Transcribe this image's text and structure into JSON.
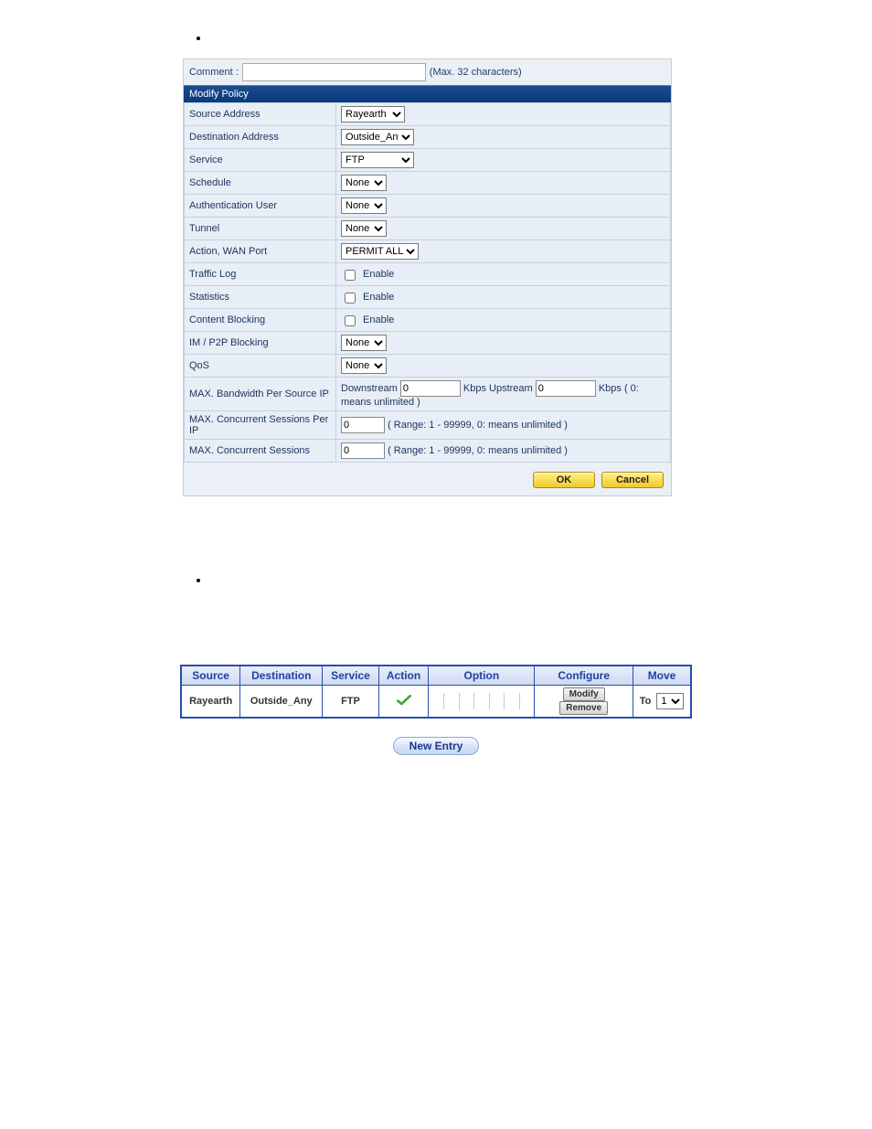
{
  "comment": {
    "label": "Comment :",
    "value": "",
    "hint": "(Max. 32 characters)"
  },
  "section_title": "Modify Policy",
  "rows": {
    "source_addr": {
      "label": "Source Address",
      "value": "Rayearth"
    },
    "dest_addr": {
      "label": "Destination Address",
      "value": "Outside_Any"
    },
    "service": {
      "label": "Service",
      "value": "FTP"
    },
    "schedule": {
      "label": "Schedule",
      "value": "None"
    },
    "auth_user": {
      "label": "Authentication User",
      "value": "None"
    },
    "tunnel": {
      "label": "Tunnel",
      "value": "None"
    },
    "action": {
      "label": "Action, WAN Port",
      "value": "PERMIT ALL"
    },
    "traffic_log": {
      "label": "Traffic Log",
      "chk_label": "Enable"
    },
    "statistics": {
      "label": "Statistics",
      "chk_label": "Enable"
    },
    "content_block": {
      "label": "Content Blocking",
      "chk_label": "Enable"
    },
    "imp2p": {
      "label": "IM / P2P Blocking",
      "value": "None"
    },
    "qos": {
      "label": "QoS",
      "value": "None"
    },
    "bw": {
      "label": "MAX. Bandwidth Per Source IP",
      "down_lbl": "Downstream",
      "down_val": "0",
      "up_lbl": "Kbps Upstream",
      "up_val": "0",
      "suffix": "Kbps ( 0: means unlimited )"
    },
    "sess_ip": {
      "label": "MAX. Concurrent Sessions Per IP",
      "value": "0",
      "hint": "( Range: 1 - 99999, 0: means unlimited )"
    },
    "sess": {
      "label": "MAX. Concurrent Sessions",
      "value": "0",
      "hint": "( Range: 1 - 99999, 0: means unlimited )"
    }
  },
  "buttons": {
    "ok": "OK",
    "cancel": "Cancel"
  },
  "grid": {
    "headers": {
      "source": "Source",
      "dest": "Destination",
      "service": "Service",
      "action": "Action",
      "option": "Option",
      "configure": "Configure",
      "move": "Move"
    },
    "row": {
      "source": "Rayearth",
      "dest": "Outside_Any",
      "service": "FTP",
      "modify": "Modify",
      "remove": "Remove",
      "move_lbl": "To",
      "move_val": "1"
    },
    "new_entry": "New Entry"
  }
}
